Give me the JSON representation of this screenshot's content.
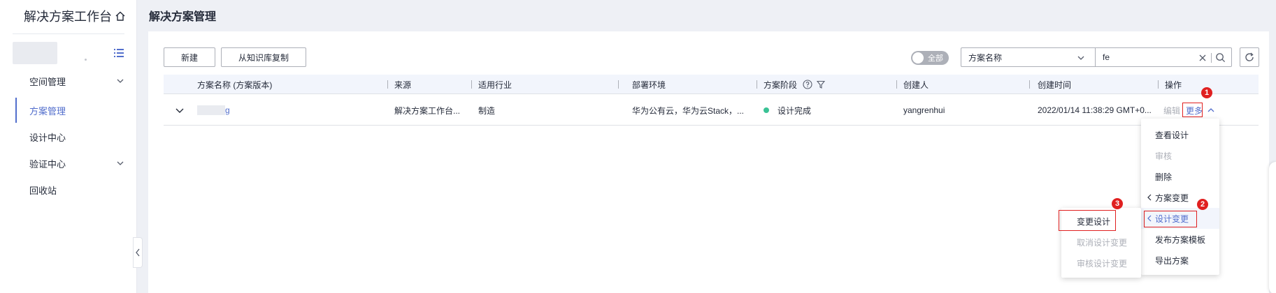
{
  "sidebar": {
    "title": "解决方案工作台",
    "items": [
      {
        "label": "空间管理",
        "has_arrow": true
      },
      {
        "label": "方案管理",
        "active": true
      },
      {
        "label": "设计中心"
      },
      {
        "label": "验证中心",
        "has_arrow": true
      },
      {
        "label": "回收站"
      }
    ]
  },
  "header": {
    "title": "解决方案管理"
  },
  "toolbar": {
    "new_label": "新建",
    "copy_label": "从知识库复制",
    "toggle_label": "全部",
    "filter_select": "方案名称",
    "search_value": "fe"
  },
  "table": {
    "columns": [
      "方案名称 (方案版本)",
      "来源",
      "适用行业",
      "部署环境",
      "方案阶段",
      "创建人",
      "创建时间",
      "操作"
    ],
    "rows": [
      {
        "name_suffix": "g",
        "source": "解决方案工作台...",
        "industry": "制造",
        "environment": "华为公有云，华为云Stack，...",
        "stage": "设计完成",
        "creator": "yangrenhui",
        "created": "2022/01/14 11:38:29 GMT+0...",
        "action_edit": "编辑",
        "action_more": "更多"
      }
    ]
  },
  "more_menu": {
    "items": [
      {
        "label": "查看设计",
        "disabled": false
      },
      {
        "label": "审核",
        "disabled": true
      },
      {
        "label": "删除",
        "disabled": false
      },
      {
        "label": "方案变更",
        "disabled": false,
        "submenu": true
      },
      {
        "label": "设计变更",
        "disabled": false,
        "submenu": true,
        "highlight": true
      },
      {
        "label": "发布方案模板",
        "disabled": false
      },
      {
        "label": "导出方案",
        "disabled": false
      }
    ]
  },
  "sub_menu": {
    "items": [
      {
        "label": "变更设计",
        "disabled": false
      },
      {
        "label": "取消设计变更",
        "disabled": true
      },
      {
        "label": "审核设计变更",
        "disabled": true
      }
    ]
  },
  "badges": [
    "1",
    "2",
    "3"
  ],
  "colors": {
    "accent": "#526ecc",
    "status_done": "#3ac295",
    "callout": "#e02020"
  }
}
